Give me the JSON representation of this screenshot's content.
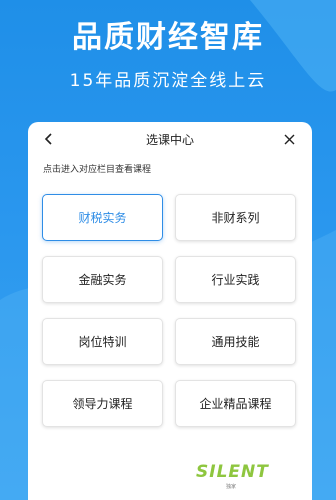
{
  "hero": {
    "title": "品质财经智库",
    "subtitle": "15年品质沉淀全线上云"
  },
  "panel": {
    "title": "选课中心",
    "hint": "点击进入对应栏目查看课程",
    "back_icon": "chevron-left-icon",
    "close_icon": "close-icon",
    "categories": [
      {
        "label": "财税实务",
        "selected": true
      },
      {
        "label": "非财系列",
        "selected": false
      },
      {
        "label": "金融实务",
        "selected": false
      },
      {
        "label": "行业实践",
        "selected": false
      },
      {
        "label": "岗位特训",
        "selected": false
      },
      {
        "label": "通用技能",
        "selected": false
      },
      {
        "label": "领导力课程",
        "selected": false
      },
      {
        "label": "企业精品课程",
        "selected": false
      }
    ]
  },
  "watermark": {
    "brand": "SILENT",
    "sub": "独家"
  },
  "colors": {
    "background": "#2a97ee",
    "accent": "#2f8de6",
    "watermark": "#8ec63f"
  }
}
